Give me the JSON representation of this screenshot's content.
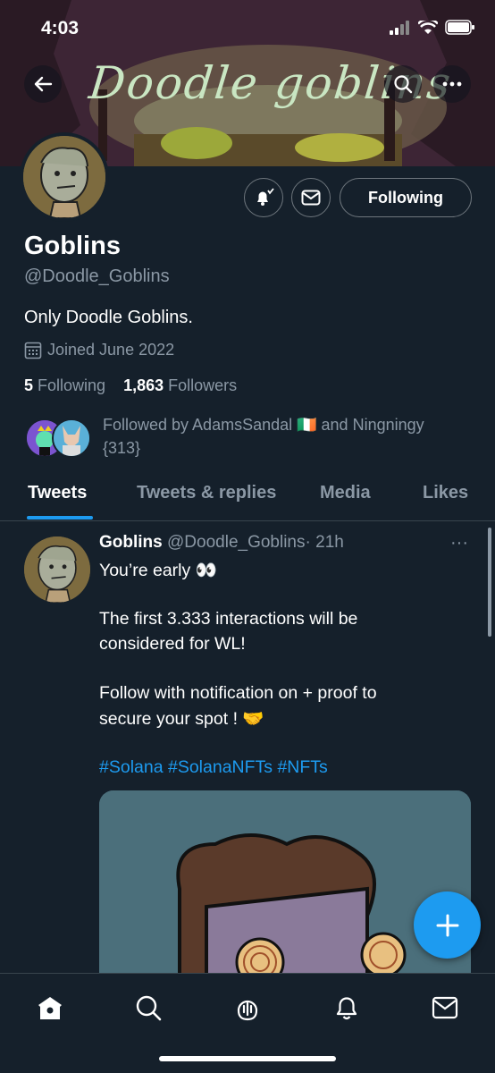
{
  "status_bar": {
    "time": "4:03"
  },
  "banner": {
    "title": "Doodle goblins"
  },
  "profile": {
    "name": "Goblins",
    "handle": "@Doodle_Goblins",
    "bio": "Only Doodle Goblins.",
    "joined": "Joined June 2022",
    "following_count": "5",
    "following_label": "Following",
    "followers_count": "1,863",
    "followers_label": "Followers",
    "followed_by_line1": "Followed by AdamsSandal 🇮🇪 and Ningningy",
    "followed_by_line2": "{313}",
    "follow_button_label": "Following"
  },
  "tabs": [
    {
      "label": "Tweets",
      "active": true
    },
    {
      "label": "Tweets & replies",
      "active": false
    },
    {
      "label": "Media",
      "active": false
    },
    {
      "label": "Likes",
      "active": false
    }
  ],
  "tweet": {
    "author_name": "Goblins",
    "author_handle": "@Doodle_Goblins",
    "separator": "·",
    "time": "21h",
    "more": "···",
    "lines": [
      "You’re early 👀",
      "The first 3.333 interactions will be",
      "considered for WL!",
      "Follow with notification on + proof to",
      "secure your spot ! 🤝"
    ],
    "hashtags": "#Solana #SolanaNFTs #NFTs"
  },
  "icons": {
    "back": "back-arrow-icon",
    "search": "search-icon",
    "more": "more-icon",
    "bell": "bell-icon",
    "mail": "mail-icon",
    "calendar": "calendar-icon",
    "fab": "plus-icon",
    "nav": [
      "home-icon",
      "search-icon",
      "spaces-icon",
      "notifications-icon",
      "messages-icon"
    ]
  },
  "colors": {
    "accent": "#1d9bf0",
    "background": "#15202b",
    "muted": "#8b98a5"
  }
}
